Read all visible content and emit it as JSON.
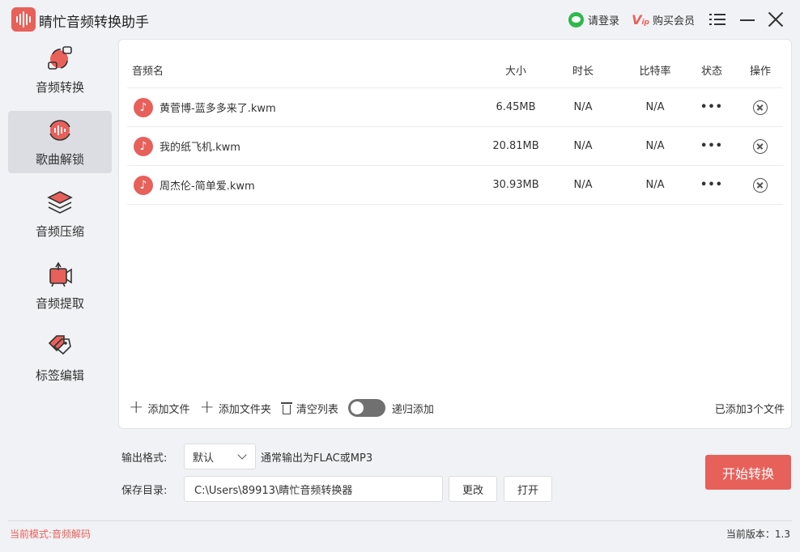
{
  "app": {
    "title": "睛忙音频转换助手"
  },
  "titlebar": {
    "login_label": "请登录",
    "vip_label": "购买会员",
    "vip_badge": "V",
    "vip_small": "ip"
  },
  "sidebar": {
    "items": [
      {
        "label": "音频转换",
        "icon": "audio-convert-icon"
      },
      {
        "label": "歌曲解锁",
        "icon": "song-unlock-icon",
        "active": true
      },
      {
        "label": "音频压缩",
        "icon": "audio-compress-icon"
      },
      {
        "label": "音频提取",
        "icon": "audio-extract-icon"
      },
      {
        "label": "标签编辑",
        "icon": "tag-edit-icon"
      }
    ]
  },
  "table": {
    "headers": {
      "name": "音频名",
      "size": "大小",
      "duration": "时长",
      "bitrate": "比特率",
      "status": "状态",
      "action": "操作"
    },
    "rows": [
      {
        "name": "黄菅博-蓝多多来了.kwm",
        "size": "6.45MB",
        "duration": "N/A",
        "bitrate": "N/A",
        "status": "•••"
      },
      {
        "name": "我的纸飞机.kwm",
        "size": "20.81MB",
        "duration": "N/A",
        "bitrate": "N/A",
        "status": "•••"
      },
      {
        "name": "周杰伦-简单爱.kwm",
        "size": "30.93MB",
        "duration": "N/A",
        "bitrate": "N/A",
        "status": "•••"
      }
    ]
  },
  "panel_footer": {
    "add_file": "添加文件",
    "add_folder": "添加文件夹",
    "clear_list": "清空列表",
    "recursive_add": "递归添加",
    "recursive_enabled": false,
    "added_count": "已添加3个文件"
  },
  "output": {
    "format_label": "输出格式:",
    "format_value": "默认",
    "format_hint": "通常输出为FLAC或MP3",
    "dir_label": "保存目录:",
    "dir_value": "C:\\Users\\89913\\睛忙音频转换器",
    "change_label": "更改",
    "open_label": "打开"
  },
  "start_label": "开始转换",
  "status": {
    "mode": "当前模式:音频解码",
    "version": "当前版本：1.3"
  },
  "colors": {
    "accent": "#e8605a",
    "wechat": "#2eb84b",
    "active_bg": "#dcdde3"
  }
}
